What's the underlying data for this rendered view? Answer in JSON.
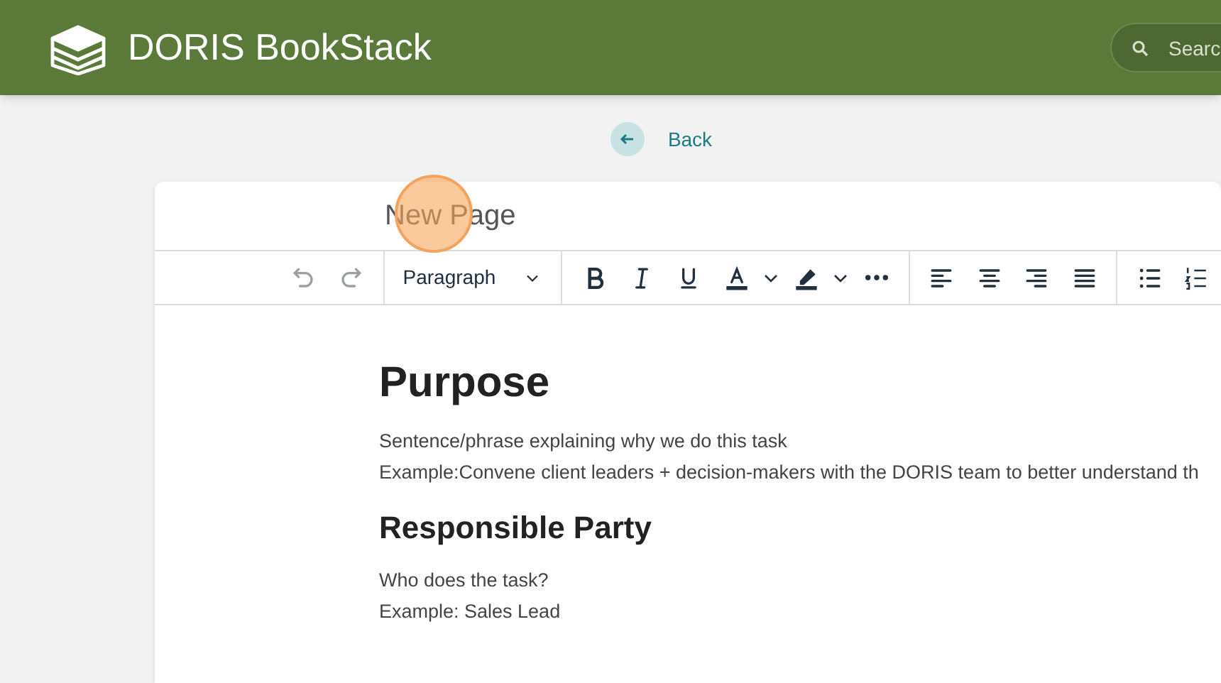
{
  "header": {
    "app_name": "DORIS BookStack",
    "search": {
      "placeholder": "Searc"
    }
  },
  "back_link": {
    "label": "Back"
  },
  "editor": {
    "title": "New Page",
    "toolbar": [
      {
        "kind": "undo",
        "disabled": true
      },
      {
        "kind": "redo",
        "disabled": true
      },
      {
        "kind": "separator"
      },
      {
        "kind": "select",
        "label": "Paragraph"
      },
      {
        "kind": "separator"
      },
      {
        "kind": "bold",
        "disabled": false
      },
      {
        "kind": "italic",
        "disabled": false
      },
      {
        "kind": "underline",
        "disabled": false
      },
      {
        "kind": "text-color",
        "disabled": false
      },
      {
        "kind": "dropdown",
        "disabled": false
      },
      {
        "kind": "highlight",
        "disabled": false
      },
      {
        "kind": "dropdown",
        "disabled": false
      },
      {
        "kind": "more",
        "disabled": false
      },
      {
        "kind": "separator"
      },
      {
        "kind": "align-left",
        "disabled": false
      },
      {
        "kind": "align-center",
        "disabled": false
      },
      {
        "kind": "align-right",
        "disabled": false
      },
      {
        "kind": "justify",
        "disabled": false
      },
      {
        "kind": "separator"
      },
      {
        "kind": "bullet-list",
        "disabled": false
      },
      {
        "kind": "numbered-list",
        "disabled": false
      }
    ],
    "content": [
      {
        "kind": "h1",
        "text": "Purpose"
      },
      {
        "kind": "p",
        "text": "Sentence/phrase explaining why we do this task"
      },
      {
        "kind": "p",
        "text": "Example:Convene client leaders + decision-makers with the DORIS team to better understand th"
      },
      {
        "kind": "h2",
        "text": "Responsible Party"
      },
      {
        "kind": "p",
        "text": "Who does the task?"
      },
      {
        "kind": "p",
        "text": "Example: Sales Lead"
      }
    ]
  }
}
